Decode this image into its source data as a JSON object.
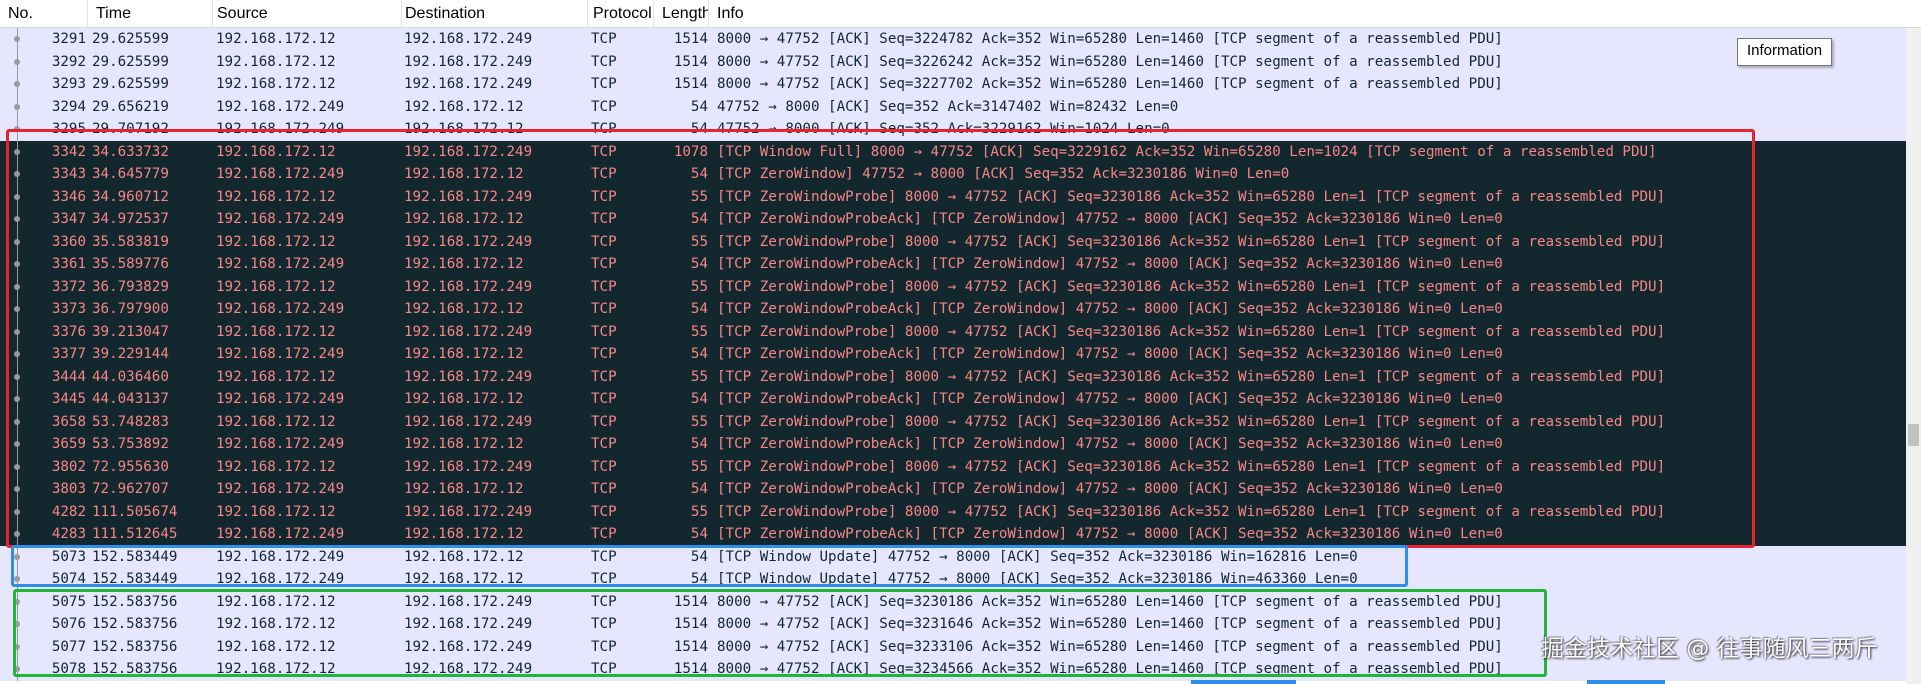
{
  "columns": {
    "no": "No.",
    "time": "Time",
    "source": "Source",
    "destination": "Destination",
    "protocol": "Protocol",
    "length": "Length",
    "info": "Info"
  },
  "tooltip": "Information",
  "watermark": "掘金技术社区 @ 往事随风三两斤",
  "colors": {
    "segment_row_bg": "#e7e6ff",
    "segment_row_fg": "#12272e",
    "zero_window_row_bg": "#12272e",
    "zero_window_row_fg": "#f78787",
    "box_red": "#e8232b",
    "box_blue": "#2f8fe8",
    "box_green": "#1fb53a"
  },
  "packets": [
    {
      "no": "3291",
      "time": "29.625599",
      "src": "192.168.172.12",
      "dst": "192.168.172.249",
      "proto": "TCP",
      "len": "1514",
      "info": "8000 → 47752 [ACK] Seq=3224782 Ack=352 Win=65280 Len=1460 [TCP segment of a reassembled PDU]",
      "style": "seg"
    },
    {
      "no": "3292",
      "time": "29.625599",
      "src": "192.168.172.12",
      "dst": "192.168.172.249",
      "proto": "TCP",
      "len": "1514",
      "info": "8000 → 47752 [ACK] Seq=3226242 Ack=352 Win=65280 Len=1460 [TCP segment of a reassembled PDU]",
      "style": "seg"
    },
    {
      "no": "3293",
      "time": "29.625599",
      "src": "192.168.172.12",
      "dst": "192.168.172.249",
      "proto": "TCP",
      "len": "1514",
      "info": "8000 → 47752 [ACK] Seq=3227702 Ack=352 Win=65280 Len=1460 [TCP segment of a reassembled PDU]",
      "style": "seg"
    },
    {
      "no": "3294",
      "time": "29.656219",
      "src": "192.168.172.249",
      "dst": "192.168.172.12",
      "proto": "TCP",
      "len": "54",
      "info": "47752 → 8000 [ACK] Seq=352 Ack=3147402 Win=82432 Len=0",
      "style": "seg"
    },
    {
      "no": "3295",
      "time": "29.707192",
      "src": "192.168.172.249",
      "dst": "192.168.172.12",
      "proto": "TCP",
      "len": "54",
      "info": "47752 → 8000 [ACK] Seq=352 Ack=3229162 Win=1024 Len=0",
      "style": "seg"
    },
    {
      "no": "3342",
      "time": "34.633732",
      "src": "192.168.172.12",
      "dst": "192.168.172.249",
      "proto": "TCP",
      "len": "1078",
      "info": "[TCP Window Full] 8000 → 47752 [ACK] Seq=3229162 Ack=352 Win=65280 Len=1024 [TCP segment of a reassembled PDU]",
      "style": "zw"
    },
    {
      "no": "3343",
      "time": "34.645779",
      "src": "192.168.172.249",
      "dst": "192.168.172.12",
      "proto": "TCP",
      "len": "54",
      "info": "[TCP ZeroWindow] 47752 → 8000 [ACK] Seq=352 Ack=3230186 Win=0 Len=0",
      "style": "zw"
    },
    {
      "no": "3346",
      "time": "34.960712",
      "src": "192.168.172.12",
      "dst": "192.168.172.249",
      "proto": "TCP",
      "len": "55",
      "info": "[TCP ZeroWindowProbe] 8000 → 47752 [ACK] Seq=3230186 Ack=352 Win=65280 Len=1 [TCP segment of a reassembled PDU]",
      "style": "zw"
    },
    {
      "no": "3347",
      "time": "34.972537",
      "src": "192.168.172.249",
      "dst": "192.168.172.12",
      "proto": "TCP",
      "len": "54",
      "info": "[TCP ZeroWindowProbeAck] [TCP ZeroWindow] 47752 → 8000 [ACK] Seq=352 Ack=3230186 Win=0 Len=0",
      "style": "zw"
    },
    {
      "no": "3360",
      "time": "35.583819",
      "src": "192.168.172.12",
      "dst": "192.168.172.249",
      "proto": "TCP",
      "len": "55",
      "info": "[TCP ZeroWindowProbe] 8000 → 47752 [ACK] Seq=3230186 Ack=352 Win=65280 Len=1 [TCP segment of a reassembled PDU]",
      "style": "zw"
    },
    {
      "no": "3361",
      "time": "35.589776",
      "src": "192.168.172.249",
      "dst": "192.168.172.12",
      "proto": "TCP",
      "len": "54",
      "info": "[TCP ZeroWindowProbeAck] [TCP ZeroWindow] 47752 → 8000 [ACK] Seq=352 Ack=3230186 Win=0 Len=0",
      "style": "zw"
    },
    {
      "no": "3372",
      "time": "36.793829",
      "src": "192.168.172.12",
      "dst": "192.168.172.249",
      "proto": "TCP",
      "len": "55",
      "info": "[TCP ZeroWindowProbe] 8000 → 47752 [ACK] Seq=3230186 Ack=352 Win=65280 Len=1 [TCP segment of a reassembled PDU]",
      "style": "zw"
    },
    {
      "no": "3373",
      "time": "36.797900",
      "src": "192.168.172.249",
      "dst": "192.168.172.12",
      "proto": "TCP",
      "len": "54",
      "info": "[TCP ZeroWindowProbeAck] [TCP ZeroWindow] 47752 → 8000 [ACK] Seq=352 Ack=3230186 Win=0 Len=0",
      "style": "zw"
    },
    {
      "no": "3376",
      "time": "39.213047",
      "src": "192.168.172.12",
      "dst": "192.168.172.249",
      "proto": "TCP",
      "len": "55",
      "info": "[TCP ZeroWindowProbe] 8000 → 47752 [ACK] Seq=3230186 Ack=352 Win=65280 Len=1 [TCP segment of a reassembled PDU]",
      "style": "zw"
    },
    {
      "no": "3377",
      "time": "39.229144",
      "src": "192.168.172.249",
      "dst": "192.168.172.12",
      "proto": "TCP",
      "len": "54",
      "info": "[TCP ZeroWindowProbeAck] [TCP ZeroWindow] 47752 → 8000 [ACK] Seq=352 Ack=3230186 Win=0 Len=0",
      "style": "zw"
    },
    {
      "no": "3444",
      "time": "44.036460",
      "src": "192.168.172.12",
      "dst": "192.168.172.249",
      "proto": "TCP",
      "len": "55",
      "info": "[TCP ZeroWindowProbe] 8000 → 47752 [ACK] Seq=3230186 Ack=352 Win=65280 Len=1 [TCP segment of a reassembled PDU]",
      "style": "zw"
    },
    {
      "no": "3445",
      "time": "44.043137",
      "src": "192.168.172.249",
      "dst": "192.168.172.12",
      "proto": "TCP",
      "len": "54",
      "info": "[TCP ZeroWindowProbeAck] [TCP ZeroWindow] 47752 → 8000 [ACK] Seq=352 Ack=3230186 Win=0 Len=0",
      "style": "zw"
    },
    {
      "no": "3658",
      "time": "53.748283",
      "src": "192.168.172.12",
      "dst": "192.168.172.249",
      "proto": "TCP",
      "len": "55",
      "info": "[TCP ZeroWindowProbe] 8000 → 47752 [ACK] Seq=3230186 Ack=352 Win=65280 Len=1 [TCP segment of a reassembled PDU]",
      "style": "zw"
    },
    {
      "no": "3659",
      "time": "53.753892",
      "src": "192.168.172.249",
      "dst": "192.168.172.12",
      "proto": "TCP",
      "len": "54",
      "info": "[TCP ZeroWindowProbeAck] [TCP ZeroWindow] 47752 → 8000 [ACK] Seq=352 Ack=3230186 Win=0 Len=0",
      "style": "zw"
    },
    {
      "no": "3802",
      "time": "72.955630",
      "src": "192.168.172.12",
      "dst": "192.168.172.249",
      "proto": "TCP",
      "len": "55",
      "info": "[TCP ZeroWindowProbe] 8000 → 47752 [ACK] Seq=3230186 Ack=352 Win=65280 Len=1 [TCP segment of a reassembled PDU]",
      "style": "zw"
    },
    {
      "no": "3803",
      "time": "72.962707",
      "src": "192.168.172.249",
      "dst": "192.168.172.12",
      "proto": "TCP",
      "len": "54",
      "info": "[TCP ZeroWindowProbeAck] [TCP ZeroWindow] 47752 → 8000 [ACK] Seq=352 Ack=3230186 Win=0 Len=0",
      "style": "zw"
    },
    {
      "no": "4282",
      "time": "111.505674",
      "src": "192.168.172.12",
      "dst": "192.168.172.249",
      "proto": "TCP",
      "len": "55",
      "info": "[TCP ZeroWindowProbe] 8000 → 47752 [ACK] Seq=3230186 Ack=352 Win=65280 Len=1 [TCP segment of a reassembled PDU]",
      "style": "zw"
    },
    {
      "no": "4283",
      "time": "111.512645",
      "src": "192.168.172.249",
      "dst": "192.168.172.12",
      "proto": "TCP",
      "len": "54",
      "info": "[TCP ZeroWindowProbeAck] [TCP ZeroWindow] 47752 → 8000 [ACK] Seq=352 Ack=3230186 Win=0 Len=0",
      "style": "zw"
    },
    {
      "no": "5073",
      "time": "152.583449",
      "src": "192.168.172.249",
      "dst": "192.168.172.12",
      "proto": "TCP",
      "len": "54",
      "info": "[TCP Window Update] 47752 → 8000 [ACK] Seq=352 Ack=3230186 Win=162816 Len=0",
      "style": "seg"
    },
    {
      "no": "5074",
      "time": "152.583449",
      "src": "192.168.172.249",
      "dst": "192.168.172.12",
      "proto": "TCP",
      "len": "54",
      "info": "[TCP Window Update] 47752 → 8000 [ACK] Seq=352 Ack=3230186 Win=463360 Len=0",
      "style": "seg"
    },
    {
      "no": "5075",
      "time": "152.583756",
      "src": "192.168.172.12",
      "dst": "192.168.172.249",
      "proto": "TCP",
      "len": "1514",
      "info": "8000 → 47752 [ACK] Seq=3230186 Ack=352 Win=65280 Len=1460 [TCP segment of a reassembled PDU]",
      "style": "seg"
    },
    {
      "no": "5076",
      "time": "152.583756",
      "src": "192.168.172.12",
      "dst": "192.168.172.249",
      "proto": "TCP",
      "len": "1514",
      "info": "8000 → 47752 [ACK] Seq=3231646 Ack=352 Win=65280 Len=1460 [TCP segment of a reassembled PDU]",
      "style": "seg"
    },
    {
      "no": "5077",
      "time": "152.583756",
      "src": "192.168.172.12",
      "dst": "192.168.172.249",
      "proto": "TCP",
      "len": "1514",
      "info": "8000 → 47752 [ACK] Seq=3233106 Ack=352 Win=65280 Len=1460 [TCP segment of a reassembled PDU]",
      "style": "seg"
    },
    {
      "no": "5078",
      "time": "152.583756",
      "src": "192.168.172.12",
      "dst": "192.168.172.249",
      "proto": "TCP",
      "len": "1514",
      "info": "8000 → 47752 [ACK] Seq=3234566 Ack=352 Win=65280 Len=1460 [TCP segment of a reassembled PDU]",
      "style": "seg"
    }
  ]
}
